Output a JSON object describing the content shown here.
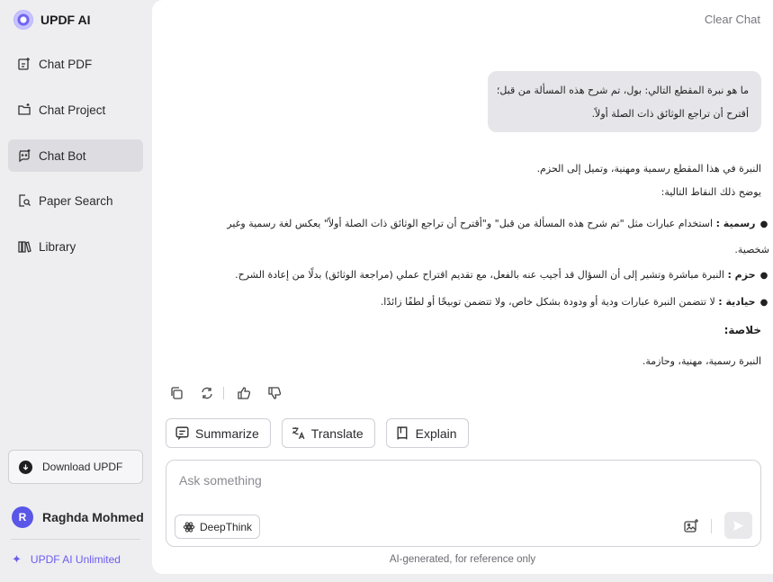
{
  "app": {
    "name": "UPDF AI"
  },
  "sidebar": {
    "items": [
      {
        "label": "Chat PDF",
        "icon": "chat-pdf-icon",
        "active": false
      },
      {
        "label": "Chat Project",
        "icon": "folder-chat-icon",
        "active": false
      },
      {
        "label": "Chat Bot",
        "icon": "bot-icon",
        "active": true
      },
      {
        "label": "Paper Search",
        "icon": "paper-search-icon",
        "active": false
      },
      {
        "label": "Library",
        "icon": "library-icon",
        "active": false
      }
    ],
    "download_label": "Download UPDF",
    "user": {
      "initial": "R",
      "name": "Raghda Mohmed"
    },
    "unlimited_label": "UPDF AI Unlimited"
  },
  "header": {
    "clear_label": "Clear Chat"
  },
  "conversation": {
    "user_message": {
      "line1": "ما هو نبرة المقطع التالي: بول، تم شرح هذه المسألة من قبل؛",
      "line2": "أقترح أن تراجع الوثائق ذات الصلة أولاً."
    },
    "answer": {
      "intro": "النبرة في هذا المقطع رسمية ومهنية، وتميل إلى الحزم.",
      "explain": "يوضح ذلك النقاط التالية:",
      "bullets": [
        {
          "term": "رسمية :",
          "text": "استخدام عبارات مثل \"تم شرح هذه المسألة من قبل\" و\"أقترح أن تراجع الوثائق ذات الصلة أولاً\" يعكس لغة رسمية وغير",
          "cont": "شخصية."
        },
        {
          "term": "حزم :",
          "text": "النبرة مباشرة وتشير إلى أن السؤال قد أجيب عنه بالفعل، مع تقديم اقتراح عملي (مراجعة الوثائق) بدلًا من إعادة الشرح."
        },
        {
          "term": "حيادية :",
          "text": "لا تتضمن النبرة عبارات ودية أو ودودة بشكل خاص، ولا تتضمن توبيخًا أو لطفًا زائدًا."
        }
      ],
      "conclusion_title": "خلاصة:",
      "conclusion_text": "النبرة رسمية، مهنية، وحازمة."
    }
  },
  "quick_actions": [
    {
      "label": "Summarize",
      "icon": "summarize-icon"
    },
    {
      "label": "Translate",
      "icon": "translate-icon"
    },
    {
      "label": "Explain",
      "icon": "book-icon"
    }
  ],
  "composer": {
    "placeholder": "Ask something",
    "deepthink_label": "DeepThink"
  },
  "footer": {
    "disclaimer": "AI-generated, for reference only"
  },
  "colors": {
    "accent": "#6a5cf0",
    "active_nav": "#dcdce1",
    "sidebar_bg": "#eeeef1"
  }
}
